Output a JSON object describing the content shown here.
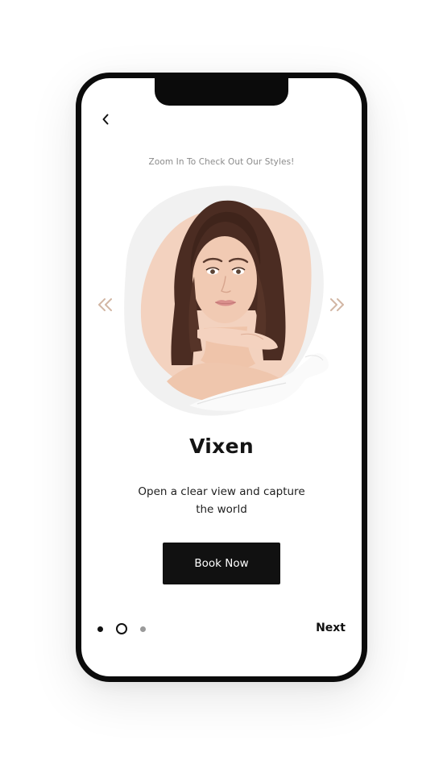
{
  "screen": {
    "subtitle": "Zoom In To Check Out Our Styles!",
    "style_title": "Vixen",
    "style_description": "Open a clear view and capture the world",
    "cta_label": "Book Now",
    "next_label": "Next"
  },
  "pager": {
    "count": 3,
    "active_index": 1
  },
  "icons": {
    "back": "chevron-left-icon",
    "prev": "double-chevron-left-icon",
    "next": "double-chevron-right-icon"
  },
  "colors": {
    "accent_arrow": "#d2b6a4",
    "frame": "#0b0b0b",
    "button_bg": "#111111",
    "blob_bg": "#f1f1f1",
    "peach_blob": "#f3d2bf"
  }
}
